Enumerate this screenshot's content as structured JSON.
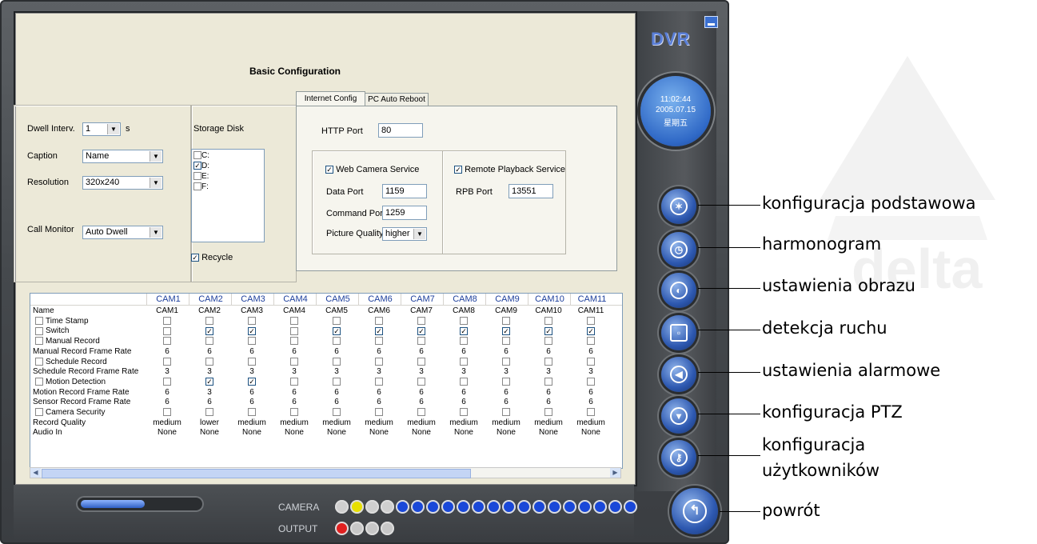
{
  "brand": "DVR",
  "clock": {
    "time": "11:02:44",
    "date": "2005.07.15",
    "weekday": "星期五"
  },
  "watermark": "delta",
  "page_title": "Basic Configuration",
  "left_panel": {
    "dwell_label": "Dwell Interv.",
    "dwell_value": "1",
    "dwell_unit": "s",
    "caption_label": "Caption",
    "caption_value": "Name",
    "resolution_label": "Resolution",
    "resolution_value": "320x240",
    "call_monitor_label": "Call Monitor",
    "call_monitor_value": "Auto Dwell"
  },
  "storage": {
    "label": "Storage Disk",
    "disks": [
      {
        "name": "C:",
        "checked": false
      },
      {
        "name": "D:",
        "checked": true
      },
      {
        "name": "E:",
        "checked": false
      },
      {
        "name": "F:",
        "checked": false
      }
    ],
    "recycle_label": "Recycle",
    "recycle_checked": true
  },
  "tabs": [
    "Internet Config",
    "PC Auto Reboot"
  ],
  "internet": {
    "http_port_label": "HTTP Port",
    "http_port_value": "80",
    "web_camera_label": "Web Camera Service",
    "data_port_label": "Data Port",
    "data_port_value": "1159",
    "command_port_label": "Command Port",
    "command_port_value": "1259",
    "picture_quality_label": "Picture Quality",
    "picture_quality_value": "higher",
    "remote_playback_label": "Remote Playback Service",
    "rpb_port_label": "RPB Port",
    "rpb_port_value": "13551"
  },
  "camera_table": {
    "columns": [
      "CAM1",
      "CAM2",
      "CAM3",
      "CAM4",
      "CAM5",
      "CAM6",
      "CAM7",
      "CAM8",
      "CAM9",
      "CAM10",
      "CAM11"
    ],
    "rows": [
      {
        "label": "Name",
        "values": [
          "CAM1",
          "CAM2",
          "CAM3",
          "CAM4",
          "CAM5",
          "CAM6",
          "CAM7",
          "CAM8",
          "CAM9",
          "CAM10",
          "CAM11"
        ]
      },
      {
        "label": "Time Stamp",
        "check": true,
        "values": [
          "0",
          "0",
          "0",
          "0",
          "0",
          "0",
          "0",
          "0",
          "0",
          "0",
          "0"
        ]
      },
      {
        "label": "Switch",
        "check": true,
        "values": [
          "0",
          "1",
          "1",
          "0",
          "1",
          "1",
          "1",
          "1",
          "1",
          "1",
          "1"
        ]
      },
      {
        "label": "Manual Record",
        "check": true,
        "values": [
          "0",
          "0",
          "0",
          "0",
          "0",
          "0",
          "0",
          "0",
          "0",
          "0",
          "0"
        ]
      },
      {
        "label": "Manual Record Frame Rate",
        "values": [
          "6",
          "6",
          "6",
          "6",
          "6",
          "6",
          "6",
          "6",
          "6",
          "6",
          "6"
        ]
      },
      {
        "label": "Schedule Record",
        "check": true,
        "values": [
          "0",
          "0",
          "0",
          "0",
          "0",
          "0",
          "0",
          "0",
          "0",
          "0",
          "0"
        ]
      },
      {
        "label": "Schedule Record Frame Rate",
        "values": [
          "3",
          "3",
          "3",
          "3",
          "3",
          "3",
          "3",
          "3",
          "3",
          "3",
          "3"
        ]
      },
      {
        "label": "Motion Detection",
        "check": true,
        "values": [
          "0",
          "1",
          "1",
          "0",
          "0",
          "0",
          "0",
          "0",
          "0",
          "0",
          "0"
        ]
      },
      {
        "label": "Motion Record Frame Rate",
        "values": [
          "6",
          "3",
          "6",
          "6",
          "6",
          "6",
          "6",
          "6",
          "6",
          "6",
          "6"
        ]
      },
      {
        "label": "Sensor Record Frame Rate",
        "values": [
          "6",
          "6",
          "6",
          "6",
          "6",
          "6",
          "6",
          "6",
          "6",
          "6",
          "6"
        ]
      },
      {
        "label": "Camera Security",
        "check": true,
        "values": [
          "0",
          "0",
          "0",
          "0",
          "0",
          "0",
          "0",
          "0",
          "0",
          "0",
          "0"
        ]
      },
      {
        "label": "Record Quality",
        "values": [
          "medium",
          "lower",
          "medium",
          "medium",
          "medium",
          "medium",
          "medium",
          "medium",
          "medium",
          "medium",
          "medium"
        ]
      },
      {
        "label": "Audio In",
        "values": [
          "None",
          "None",
          "None",
          "None",
          "None",
          "None",
          "None",
          "None",
          "None",
          "None",
          "None"
        ]
      }
    ]
  },
  "bottom": {
    "camera_label": "CAMERA",
    "output_label": "OUTPUT"
  },
  "menu": [
    {
      "label": "konfiguracja podstawowa",
      "icon": "tools-icon"
    },
    {
      "label": "harmonogram",
      "icon": "clock-icon"
    },
    {
      "label": "ustawienia obrazu",
      "icon": "contrast-icon"
    },
    {
      "label": "detekcja ruchu",
      "icon": "motion-icon"
    },
    {
      "label": "ustawienia alarmowe",
      "icon": "speaker-icon"
    },
    {
      "label": "konfiguracja PTZ",
      "icon": "ptz-camera-icon"
    },
    {
      "label": "konfiguracja\nużytkowników",
      "label_line1": "konfiguracja",
      "label_line2": "użytkowników",
      "icon": "key-icon"
    },
    {
      "label": "powrót",
      "icon": "return-icon"
    }
  ]
}
